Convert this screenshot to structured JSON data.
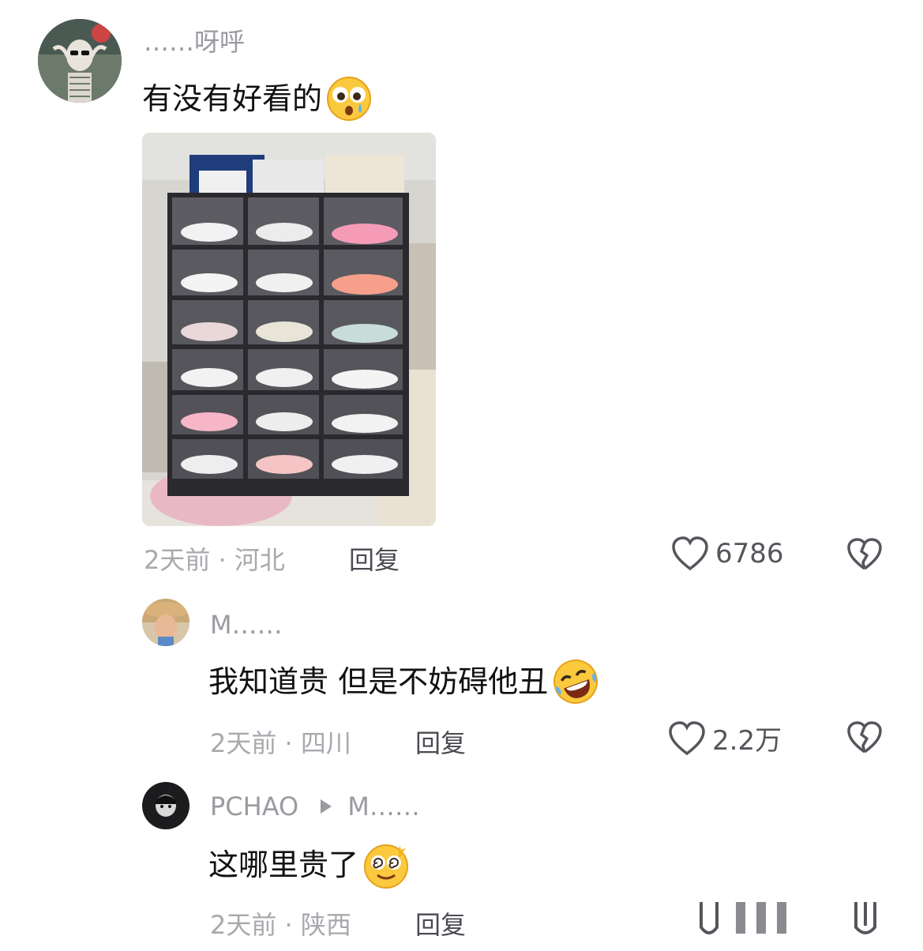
{
  "comments": [
    {
      "username": "……呀呼",
      "text": "有没有好看的",
      "emoji": "pleading-face-emoji",
      "meta": "2天前 · 河北",
      "reply_label": "回复",
      "likes": "6786"
    },
    {
      "username": "M……",
      "text": "我知道贵 但是不妨碍他丑",
      "emoji": "rolling-laughing-emoji",
      "meta": "2天前 · 四川",
      "reply_label": "回复",
      "likes": "2.2万"
    },
    {
      "username": "PCHAO",
      "reply_to": "M……",
      "text": "这哪里贵了",
      "emoji": "dizzy-face-emoji",
      "meta": "2天前 · 陕西",
      "reply_label": "回复"
    }
  ],
  "colors": {
    "username": "#9a9ba1",
    "meta": "#a8a9ae",
    "text": "#111111",
    "icon": "#55565c"
  }
}
